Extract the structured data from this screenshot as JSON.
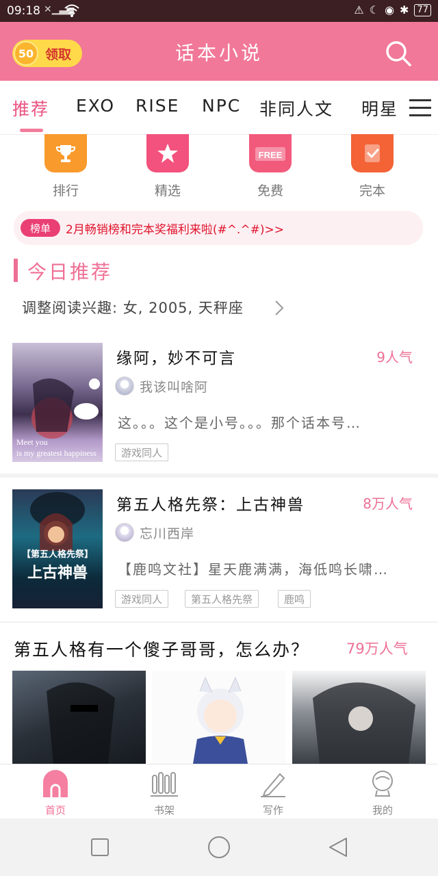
{
  "status_bar": {
    "time": "09:18",
    "battery": "77"
  },
  "header": {
    "coins": "50",
    "claim_label": "领取",
    "title": "话本小说"
  },
  "tabs": {
    "items": [
      {
        "label": "推荐",
        "active": true
      },
      {
        "label": "EXO"
      },
      {
        "label": "RISE"
      },
      {
        "label": "NPC"
      },
      {
        "label": "非同人文"
      },
      {
        "label": "明星"
      }
    ]
  },
  "categories": [
    {
      "label": "排行",
      "icon": "trophy-icon",
      "color": "#f99a2c"
    },
    {
      "label": "精选",
      "icon": "star-icon",
      "color": "#f2527d"
    },
    {
      "label": "免费",
      "icon": "free-icon",
      "color": "#f25a7c"
    },
    {
      "label": "完本",
      "icon": "check-icon",
      "color": "#f36336"
    }
  ],
  "banner": {
    "badge": "榜单",
    "text": "2月畅销榜和完本奖福利来啦(#^.^#)>>"
  },
  "section": {
    "title": "今日推荐",
    "interest": "调整阅读兴趣: 女, 2005, 天秤座"
  },
  "books": [
    {
      "title": "缘阿，妙不可言",
      "popularity": "9人气",
      "author": "我该叫啥阿",
      "description": "这。。。这个是小号。。。那个话本号…",
      "tags": [
        "游戏同人"
      ],
      "cover_text": [
        "Meet you",
        "is my greatest happiness"
      ]
    },
    {
      "title": "第五人格先祭：上古神兽",
      "popularity": "8万人气",
      "author": "忘川西岸",
      "description": "【鹿鸣文社】星天鹿满满，海低鸣长啸…",
      "tags": [
        "游戏同人",
        "第五人格先祭",
        "鹿鸣"
      ],
      "cover_text": [
        "【第五人格先祭】",
        "上古神兽"
      ]
    }
  ],
  "list3": {
    "title": "第五人格有一个傻子哥哥，怎么办？",
    "popularity": "79万人气"
  },
  "bottom_nav": [
    {
      "label": "首页",
      "active": true
    },
    {
      "label": "书架"
    },
    {
      "label": "写作"
    },
    {
      "label": "我的"
    }
  ],
  "colors": {
    "brand": "#f17898",
    "accent": "#ee6f95"
  }
}
